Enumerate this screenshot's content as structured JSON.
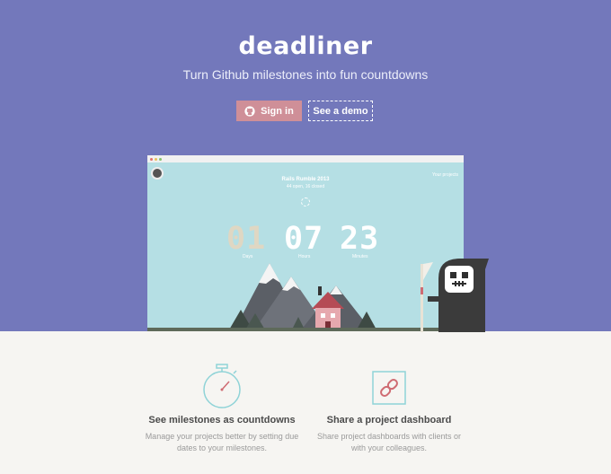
{
  "brand": {
    "name": "deadliner",
    "tagline": "Turn Github milestones into fun countdowns"
  },
  "actions": {
    "signin_label": "Sign in",
    "demo_label": "See a demo"
  },
  "colors": {
    "hero_bg": "#7378bb",
    "signin_bg": "#cf8f98",
    "preview_bg": "#b5dfe4",
    "page_bg": "#f6f5f2",
    "feature_icon": "#8fd3d7"
  },
  "preview": {
    "title": "Rails Rumble 2013",
    "subtitle": "44 open, 16 closed",
    "top_link": "Your projects",
    "countdown": {
      "days": "01",
      "hours": "07",
      "minutes": "23"
    },
    "units": {
      "days": "Days",
      "hours": "Hours",
      "minutes": "Minutes"
    }
  },
  "features": [
    {
      "icon": "stopwatch-icon",
      "title": "See milestones as countdowns",
      "desc_line1": "Manage your projects better by setting due",
      "desc_line2": "dates to your milestones."
    },
    {
      "icon": "link-icon",
      "title": "Share a project dashboard",
      "desc_line1": "Share project dashboards with clients or",
      "desc_line2": "with your colleagues."
    }
  ]
}
